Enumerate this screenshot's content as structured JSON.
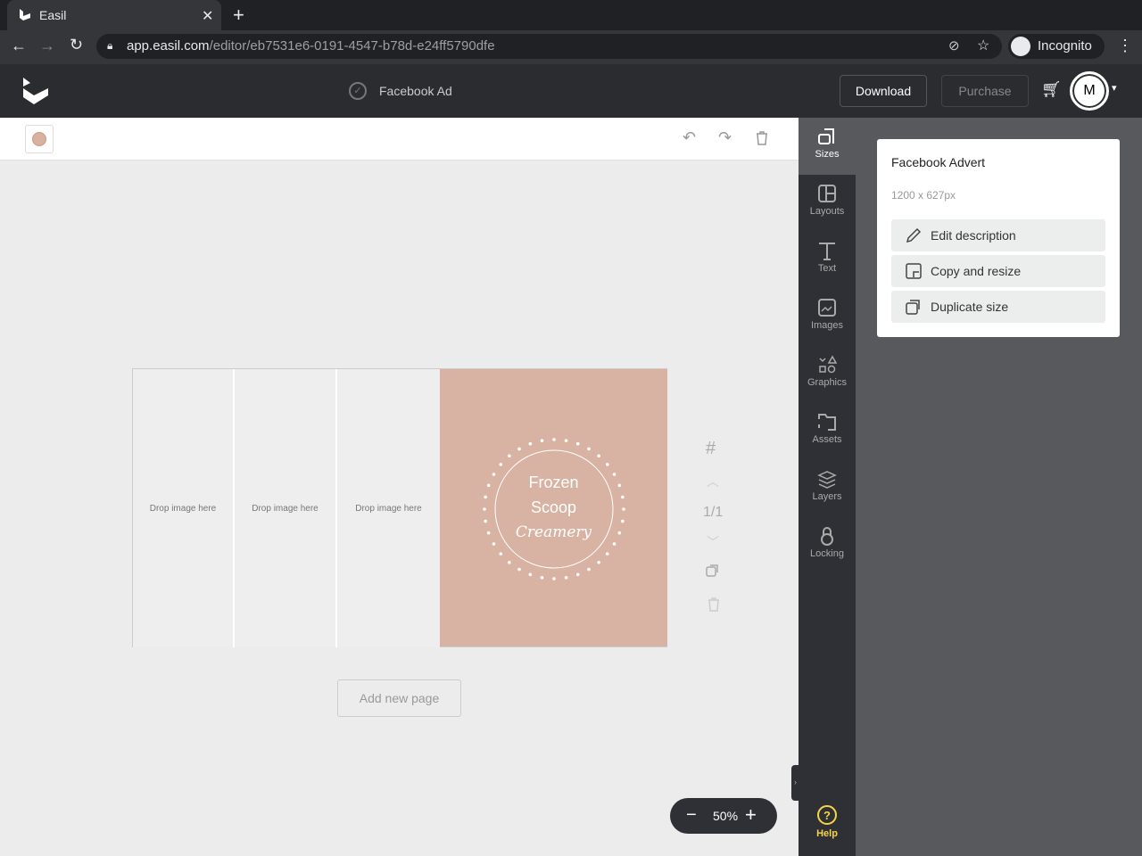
{
  "browser": {
    "tab_title": "Easil",
    "url_host": "app.easil.com",
    "url_path": "/editor/eb7531e6-0191-4547-b78d-e24ff5790dfe",
    "profile": "Incognito"
  },
  "header": {
    "design_title": "Facebook Ad",
    "download": "Download",
    "purchase": "Purchase",
    "avatar_initial": "M"
  },
  "toolbar": {
    "swatch_color": "#d8b1a0"
  },
  "canvas": {
    "drop_labels": [
      "Drop image here",
      "Drop image here",
      "Drop image here"
    ],
    "logo_line1": "Frozen",
    "logo_line2": "Scoop",
    "logo_line3": "Creamery",
    "bg_color": "#d8b3a3",
    "page_indicator": "1/1",
    "add_page": "Add new page"
  },
  "zoom": {
    "value": "50%"
  },
  "sidebar": {
    "items": [
      {
        "label": "Sizes"
      },
      {
        "label": "Layouts"
      },
      {
        "label": "Text"
      },
      {
        "label": "Images"
      },
      {
        "label": "Graphics"
      },
      {
        "label": "Assets"
      },
      {
        "label": "Layers"
      },
      {
        "label": "Locking"
      }
    ],
    "help": "Help"
  },
  "panel": {
    "title": "Facebook Advert",
    "dimensions": "1200 x 627px",
    "actions": [
      "Edit description",
      "Copy and resize",
      "Duplicate size"
    ]
  }
}
